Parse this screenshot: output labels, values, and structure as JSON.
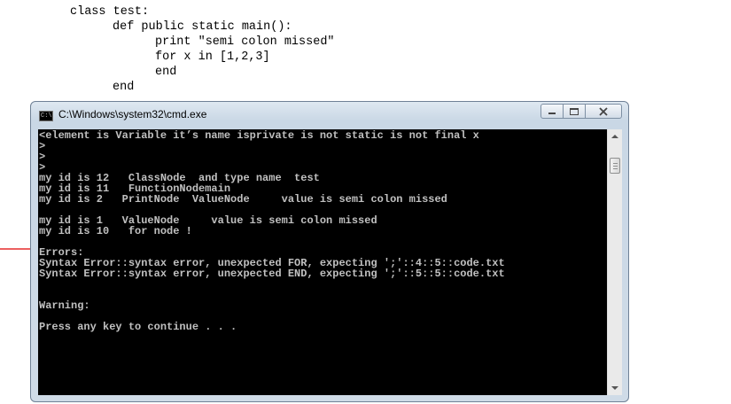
{
  "code": {
    "lines": [
      "class test:",
      "def public static main():",
      "print \"semi colon missed\"",
      "for x in [1,2,3]",
      "end",
      "end"
    ]
  },
  "window": {
    "title": "C:\\Windows\\system32\\cmd.exe",
    "icon": "cmd-icon",
    "buttons": [
      "minimize",
      "maximize",
      "close"
    ]
  },
  "console": {
    "lines": [
      "<element is Variable it’s name isprivate is not static is not final x",
      ">",
      ">",
      ">",
      "my id is 12   ClassNode  and type name  test",
      "my id is 11   FunctionNodemain",
      "my id is 2   PrintNode  ValueNode     value is semi colon missed",
      "",
      "my id is 1   ValueNode     value is semi colon missed",
      "my id is 10   for node !",
      "",
      "Errors:",
      "Syntax Error::syntax error, unexpected FOR, expecting ';'::4::5::code.txt",
      "Syntax Error::syntax error, unexpected END, expecting ';'::5::5::code.txt",
      "",
      "",
      "Warning:",
      "",
      "Press any key to continue . . ."
    ],
    "text_color": "#c0c0c0",
    "background": "#000000"
  },
  "annotation": {
    "arrow_color": "#e00000",
    "icon": "arrow-right-icon"
  }
}
